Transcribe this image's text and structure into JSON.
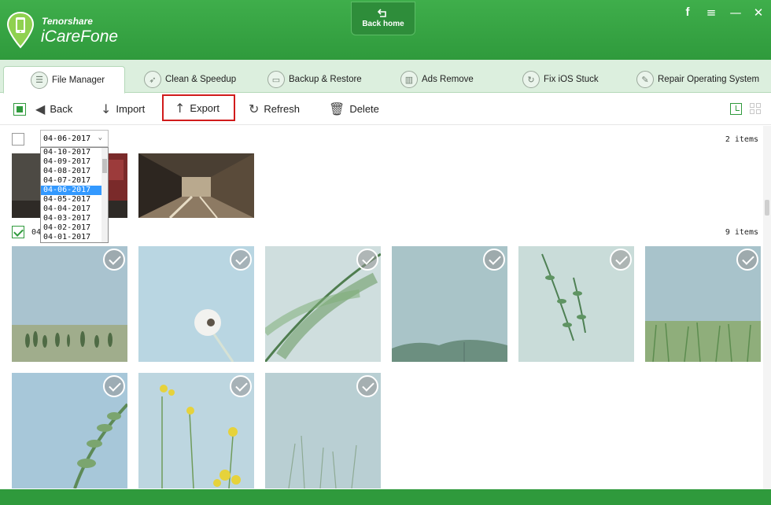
{
  "app": {
    "brand": "Tenorshare",
    "product": "iCareFone",
    "back_home_label": "Back home",
    "accent": "#2f9a3c",
    "window_controls": [
      "facebook-icon",
      "menu-icon",
      "minimize-icon",
      "close-icon"
    ]
  },
  "tabs": [
    {
      "label": "File Manager",
      "icon": "file-manager-icon",
      "active": true
    },
    {
      "label": "Clean & Speedup",
      "icon": "rocket-icon",
      "active": false
    },
    {
      "label": "Backup & Restore",
      "icon": "folder-icon",
      "active": false
    },
    {
      "label": "Ads Remove",
      "icon": "trash-icon",
      "active": false
    },
    {
      "label": "Fix iOS Stuck",
      "icon": "refresh-icon",
      "active": false
    },
    {
      "label": "Repair Operating System",
      "icon": "wrench-icon",
      "active": false
    }
  ],
  "toolbar": {
    "back": "Back",
    "import": "Import",
    "export": "Export",
    "refresh": "Refresh",
    "delete": "Delete"
  },
  "groups": [
    {
      "date": "04-06-2017",
      "count_label": "2 items",
      "checked": false
    },
    {
      "date_partial": "04",
      "count_label": "9 items",
      "checked": true
    }
  ],
  "date_dropdown": {
    "options": [
      "04-10-2017",
      "04-09-2017",
      "04-08-2017",
      "04-07-2017",
      "04-06-2017",
      "04-05-2017",
      "04-04-2017",
      "04-03-2017",
      "04-02-2017",
      "04-01-2017"
    ],
    "selected": "04-06-2017"
  }
}
